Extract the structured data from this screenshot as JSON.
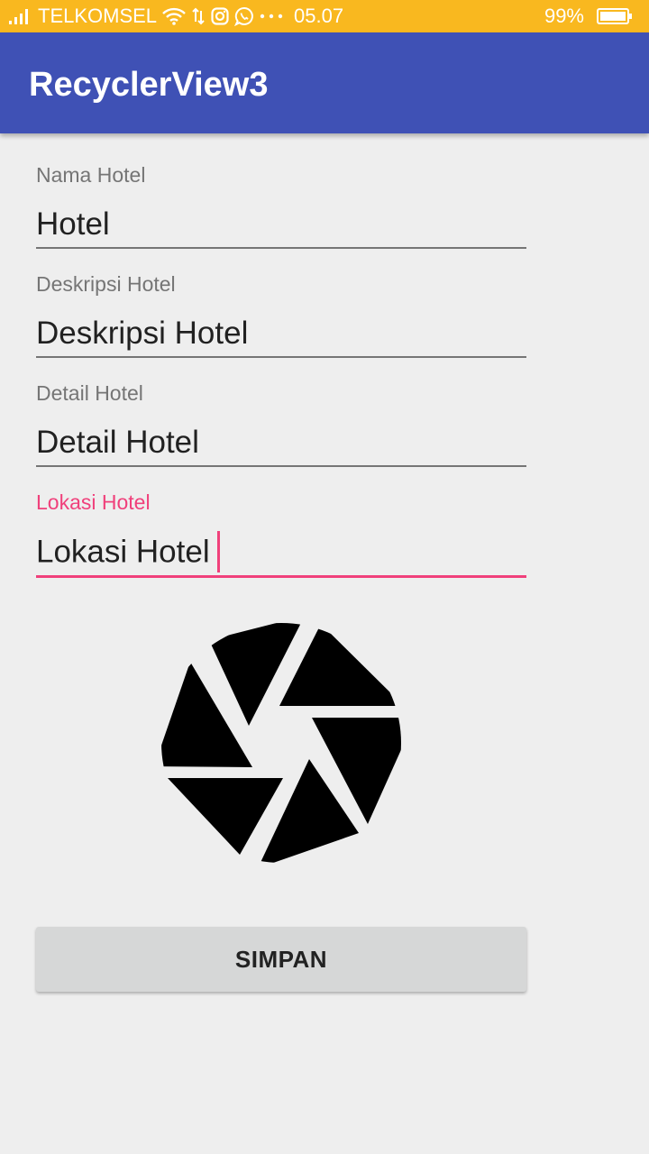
{
  "status_bar": {
    "carrier": "TELKOMSEL",
    "time": "05.07",
    "battery_percent": "99%",
    "icons": [
      "signal-icon",
      "wifi-icon",
      "data-transfer-icon",
      "instagram-icon",
      "whatsapp-icon",
      "more-notifications-icon",
      "battery-icon"
    ],
    "background_color": "#f9b81f"
  },
  "app_bar": {
    "title": "RecyclerView3",
    "background_color": "#3f51b5"
  },
  "form": {
    "fields": [
      {
        "label": "Nama Hotel",
        "value": "Hotel",
        "focused": false
      },
      {
        "label": "Deskripsi Hotel",
        "value": "Deskripsi Hotel",
        "focused": false
      },
      {
        "label": "Detail Hotel",
        "value": "Detail Hotel",
        "focused": false
      },
      {
        "label": "Lokasi Hotel",
        "value": "Lokasi Hotel",
        "focused": true
      }
    ],
    "accent_color": "#f0407b",
    "image_picker_icon": "camera-shutter-icon",
    "save_label": "SIMPAN"
  }
}
